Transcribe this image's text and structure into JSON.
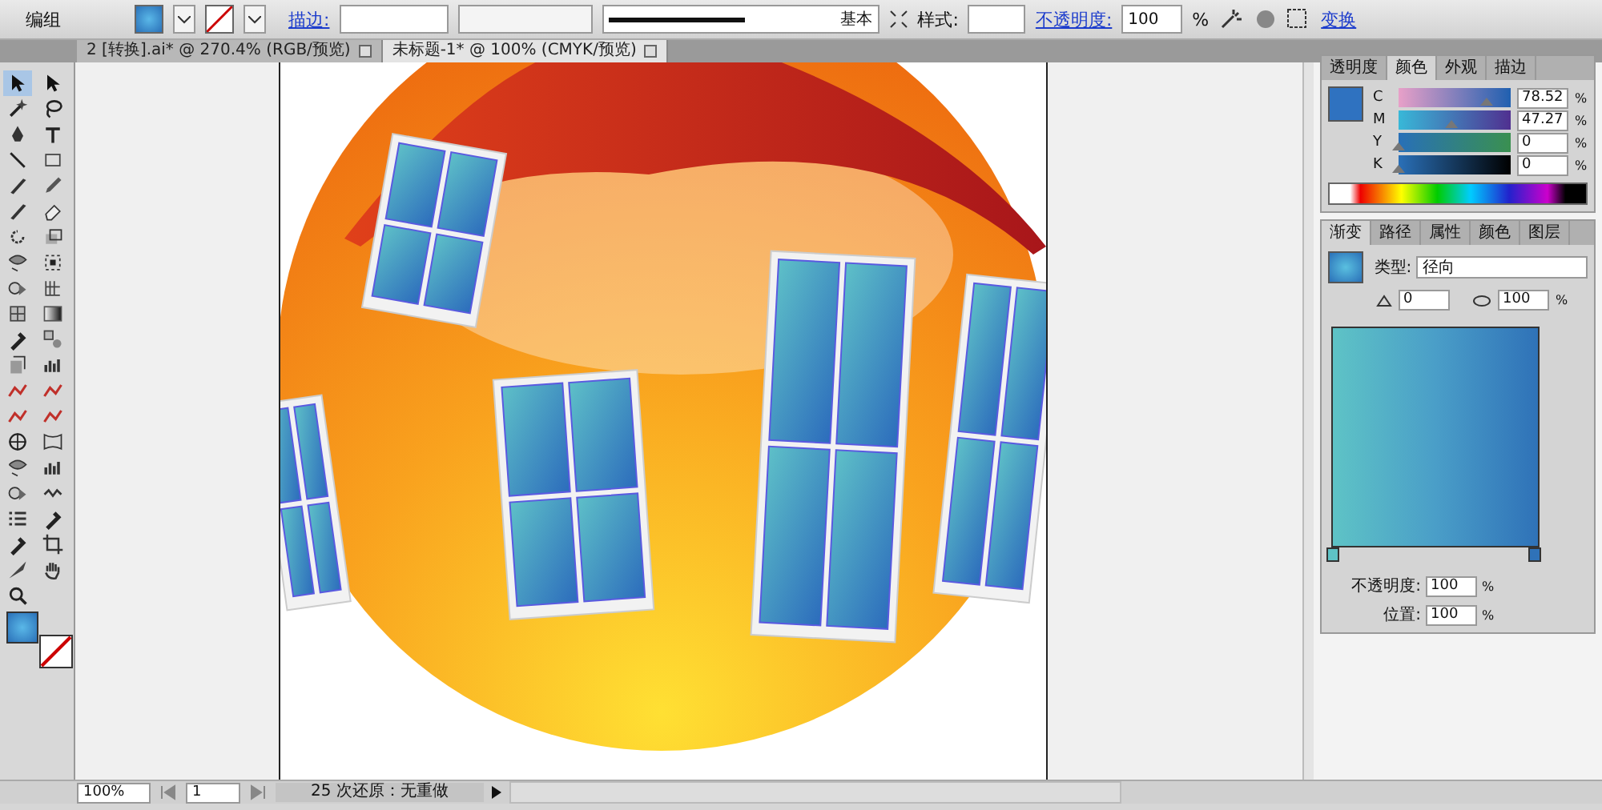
{
  "control_bar": {
    "label": "编组",
    "stroke_label": "描边:",
    "stroke_profile": "基本",
    "style_label": "样式:",
    "opacity_label": "不透明度:",
    "opacity": {
      "value": "100",
      "unit": "%"
    },
    "transform_link": "变换"
  },
  "tabs": [
    {
      "label": "2 [转换].ai* @ 270.4% (RGB/预览)",
      "selected": false
    },
    {
      "label": "未标题-1* @ 100% (CMYK/预览)",
      "selected": true
    }
  ],
  "tools": [
    {
      "kind": "arrow",
      "selected": true
    },
    {
      "kind": "arrow",
      "selected": false
    },
    {
      "kind": "wand",
      "selected": false
    },
    {
      "kind": "lasso",
      "selected": false
    },
    {
      "kind": "pen",
      "selected": false
    },
    {
      "kind": "type",
      "selected": false
    },
    {
      "kind": "line",
      "selected": false
    },
    {
      "kind": "rect",
      "selected": false
    },
    {
      "kind": "brush",
      "selected": false
    },
    {
      "kind": "pencil",
      "selected": false
    },
    {
      "kind": "brush",
      "selected": false
    },
    {
      "kind": "eraser",
      "selected": false
    },
    {
      "kind": "rotate",
      "selected": false
    },
    {
      "kind": "scale",
      "selected": false
    },
    {
      "kind": "warp",
      "selected": false
    },
    {
      "kind": "transform",
      "selected": false
    },
    {
      "kind": "shape",
      "selected": false
    },
    {
      "kind": "grid",
      "selected": false
    },
    {
      "kind": "mesh",
      "selected": false
    },
    {
      "kind": "gradient",
      "selected": false
    },
    {
      "kind": "eyedropper",
      "selected": false
    },
    {
      "kind": "blend",
      "selected": false
    },
    {
      "kind": "symbol",
      "selected": false
    },
    {
      "kind": "graph",
      "selected": false
    },
    {
      "kind": "curve",
      "selected": false
    },
    {
      "kind": "curve",
      "selected": false
    },
    {
      "kind": "curve",
      "selected": false
    },
    {
      "kind": "curve",
      "selected": false
    },
    {
      "kind": "target",
      "selected": false
    },
    {
      "kind": "envelope",
      "selected": false
    },
    {
      "kind": "warp",
      "selected": false
    },
    {
      "kind": "graph",
      "selected": false
    },
    {
      "kind": "shape",
      "selected": false
    },
    {
      "kind": "wave",
      "selected": false
    },
    {
      "kind": "list",
      "selected": false
    },
    {
      "kind": "eyedropper",
      "selected": false
    },
    {
      "kind": "eyedropper",
      "selected": false
    },
    {
      "kind": "crop",
      "selected": false
    },
    {
      "kind": "knife",
      "selected": false
    },
    {
      "kind": "hand",
      "selected": false
    },
    {
      "kind": "zoom",
      "selected": false
    }
  ],
  "color_panel": {
    "tabs": [
      {
        "label": "透明度",
        "selected": false
      },
      {
        "label": "颜色",
        "selected": true
      },
      {
        "label": "外观",
        "selected": false
      },
      {
        "label": "描边",
        "selected": false
      }
    ],
    "channels": [
      {
        "name": "C",
        "value": "78.52",
        "unit": "%",
        "level": 0.7852
      },
      {
        "name": "M",
        "value": "47.27",
        "unit": "%",
        "level": 0.4727
      },
      {
        "name": "Y",
        "value": "0",
        "unit": "%",
        "level": 0
      },
      {
        "name": "K",
        "value": "0",
        "unit": "%",
        "level": 0
      }
    ]
  },
  "gradient_panel": {
    "tabs": [
      {
        "label": "渐变",
        "selected": true
      },
      {
        "label": "路径",
        "selected": false
      },
      {
        "label": "属性",
        "selected": false
      },
      {
        "label": "颜色",
        "selected": false
      },
      {
        "label": "图层",
        "selected": false
      }
    ],
    "type_label": "类型:",
    "type": "径向",
    "angle": "0",
    "aspect": {
      "value": "100",
      "unit": "%"
    },
    "opacity_label": "不透明度:",
    "opacity": {
      "value": "100",
      "unit": "%"
    },
    "location_label": "位置:",
    "location": {
      "value": "100",
      "unit": "%"
    }
  },
  "status_bar": {
    "zoom": "100%",
    "page": "1",
    "status": "25 次还原：无重做"
  }
}
